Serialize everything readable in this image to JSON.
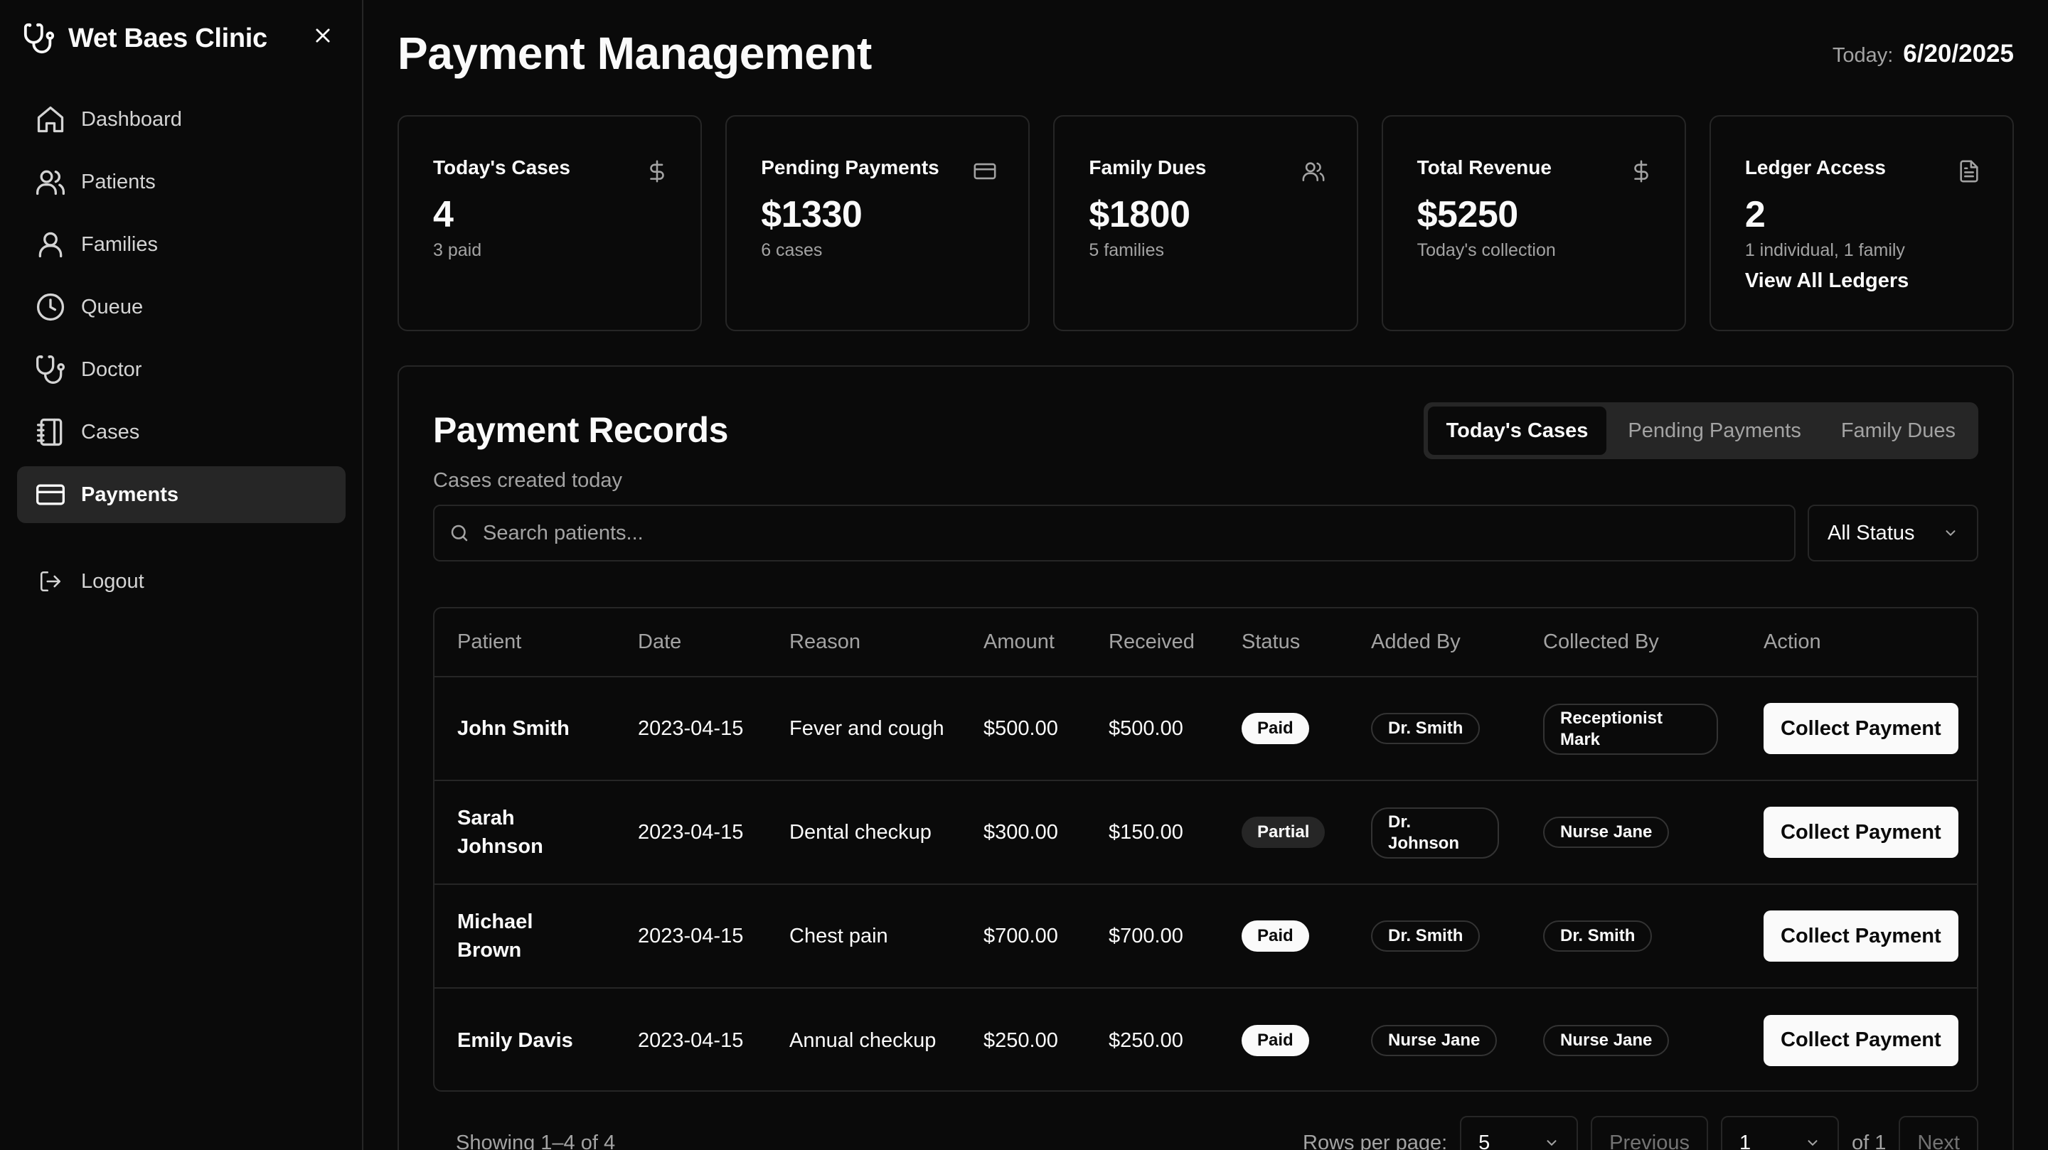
{
  "sidebar": {
    "brand": "Wet Baes Clinic",
    "items": [
      {
        "label": "Dashboard",
        "icon": "home-icon"
      },
      {
        "label": "Patients",
        "icon": "users-icon"
      },
      {
        "label": "Families",
        "icon": "user-icon"
      },
      {
        "label": "Queue",
        "icon": "clock-icon"
      },
      {
        "label": "Doctor",
        "icon": "stethoscope-icon"
      },
      {
        "label": "Cases",
        "icon": "notebook-icon"
      },
      {
        "label": "Payments",
        "icon": "credit-card-icon",
        "active": true
      }
    ],
    "logout": "Logout"
  },
  "header": {
    "title": "Payment Management",
    "today_label": "Today:",
    "today_value": "6/20/2025"
  },
  "stats": [
    {
      "label": "Today's Cases",
      "value": "4",
      "sub": "3 paid",
      "icon": "dollar-icon"
    },
    {
      "label": "Pending Payments",
      "value": "$1330",
      "sub": "6 cases",
      "icon": "credit-card-icon"
    },
    {
      "label": "Family Dues",
      "value": "$1800",
      "sub": "5 families",
      "icon": "users-icon"
    },
    {
      "label": "Total Revenue",
      "value": "$5250",
      "sub": "Today's collection",
      "icon": "dollar-icon"
    },
    {
      "label": "Ledger Access",
      "value": "2",
      "sub": "1 individual, 1 family",
      "link": "View All Ledgers",
      "icon": "document-icon"
    }
  ],
  "records": {
    "title": "Payment Records",
    "subtitle": "Cases created today",
    "tabs": [
      "Today's Cases",
      "Pending Payments",
      "Family Dues"
    ],
    "active_tab": 0,
    "search_placeholder": "Search patients...",
    "status_filter": "All Status",
    "columns": [
      "Patient",
      "Date",
      "Reason",
      "Amount",
      "Received",
      "Status",
      "Added By",
      "Collected By",
      "Action"
    ],
    "rows": [
      {
        "patient": "John Smith",
        "date": "2023-04-15",
        "reason": "Fever and cough",
        "amount": "$500.00",
        "received": "$500.00",
        "status": "Paid",
        "added_by": "Dr. Smith",
        "collected_by": "Receptionist Mark",
        "action": "Collect Payment"
      },
      {
        "patient": "Sarah Johnson",
        "date": "2023-04-15",
        "reason": "Dental checkup",
        "amount": "$300.00",
        "received": "$150.00",
        "status": "Partial",
        "added_by": "Dr. Johnson",
        "collected_by": "Nurse Jane",
        "action": "Collect Payment"
      },
      {
        "patient": "Michael Brown",
        "date": "2023-04-15",
        "reason": "Chest pain",
        "amount": "$700.00",
        "received": "$700.00",
        "status": "Paid",
        "added_by": "Dr. Smith",
        "collected_by": "Dr. Smith",
        "action": "Collect Payment"
      },
      {
        "patient": "Emily Davis",
        "date": "2023-04-15",
        "reason": "Annual checkup",
        "amount": "$250.00",
        "received": "$250.00",
        "status": "Paid",
        "added_by": "Nurse Jane",
        "collected_by": "Nurse Jane",
        "action": "Collect Payment"
      }
    ],
    "footer": {
      "showing": "Showing 1–4 of 4",
      "rows_label": "Rows per page:",
      "rows_value": "5",
      "previous": "Previous",
      "page_value": "1",
      "of_pages": "of 1",
      "next": "Next"
    }
  }
}
